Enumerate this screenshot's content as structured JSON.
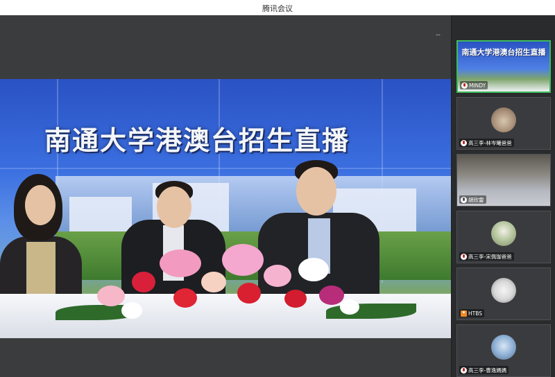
{
  "window": {
    "title": "腾讯会议"
  },
  "main": {
    "more_button": "···",
    "banner_text": "南通大学港澳台招生直播"
  },
  "participants": [
    {
      "name": "MINDY",
      "type": "video",
      "mic": "on",
      "active": true
    },
    {
      "name": "高三李-林岑曦爸爸",
      "type": "avatar",
      "mic": "on"
    },
    {
      "name": "胡欣雷",
      "type": "video",
      "mic": "off"
    },
    {
      "name": "高三李-宋佩珈爸爸",
      "type": "avatar",
      "mic": "on"
    },
    {
      "name": "HTBS",
      "type": "avatar",
      "mic": "badge"
    },
    {
      "name": "高三李-曹逸媽媽",
      "type": "avatar",
      "mic": "on"
    }
  ],
  "colors": {
    "active_border": "#3dbd5b",
    "stage_bg": "#3b3c3e",
    "panel_bg": "#2a2b2d"
  },
  "icons": [
    "more-icon",
    "mic-icon",
    "mic-off-icon",
    "user-badge-icon"
  ]
}
